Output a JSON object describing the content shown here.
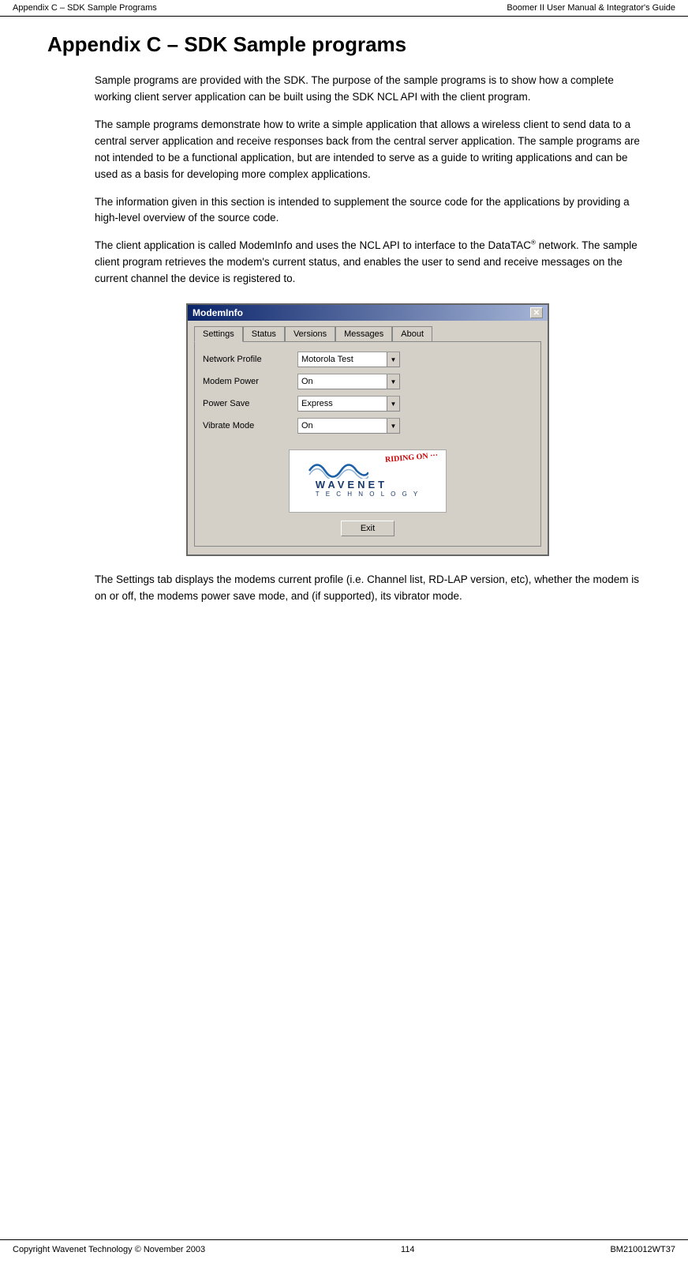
{
  "header": {
    "left": "Appendix C – SDK Sample Programs",
    "right": "Boomer II User Manual & Integrator's Guide"
  },
  "footer": {
    "left": "Copyright Wavenet Technology © November 2003",
    "center": "114",
    "right": "BM210012WT37"
  },
  "page": {
    "title": "Appendix C – SDK Sample programs",
    "paragraphs": [
      "Sample programs are provided with the SDK. The purpose of the sample programs is to show how a complete working client server application can be built using the SDK NCL API with the client program.",
      "The sample programs demonstrate how to write a simple application that allows a wireless client to send data to a central server application and receive responses back from the central server application. The sample programs are not intended to be a functional application, but are intended to serve as a guide to writing applications and can be used as a basis for developing more complex applications.",
      "The information given in this section is intended to supplement the source code for the applications by providing a high-level overview of the source code.",
      "The client application is called ModemInfo and uses the NCL API to interface to the DataTAC® network. The sample client program retrieves the modem's current status, and enables the user to send and receive messages on the current channel the device is registered to.",
      "The Settings tab displays the modems current profile (i.e. Channel list, RD-LAP version, etc), whether the modem is on or off, the modems power save mode, and (if supported), its vibrator mode."
    ]
  },
  "window": {
    "title": "ModemInfo",
    "close_btn": "✕",
    "tabs": [
      {
        "label": "Settings",
        "active": true
      },
      {
        "label": "Status"
      },
      {
        "label": "Versions"
      },
      {
        "label": "Messages"
      },
      {
        "label": "About"
      }
    ],
    "form_rows": [
      {
        "label": "Network Profile",
        "value": "Motorola Test"
      },
      {
        "label": "Modem Power",
        "value": "On"
      },
      {
        "label": "Power Save",
        "value": "Express"
      },
      {
        "label": "Vibrate Mode",
        "value": "On"
      }
    ],
    "logo": {
      "riding_text": "RIDING ON ···",
      "brand_name": "WAVENET",
      "brand_subtitle": "T E C H N O L O G Y"
    },
    "exit_btn": "Exit"
  }
}
